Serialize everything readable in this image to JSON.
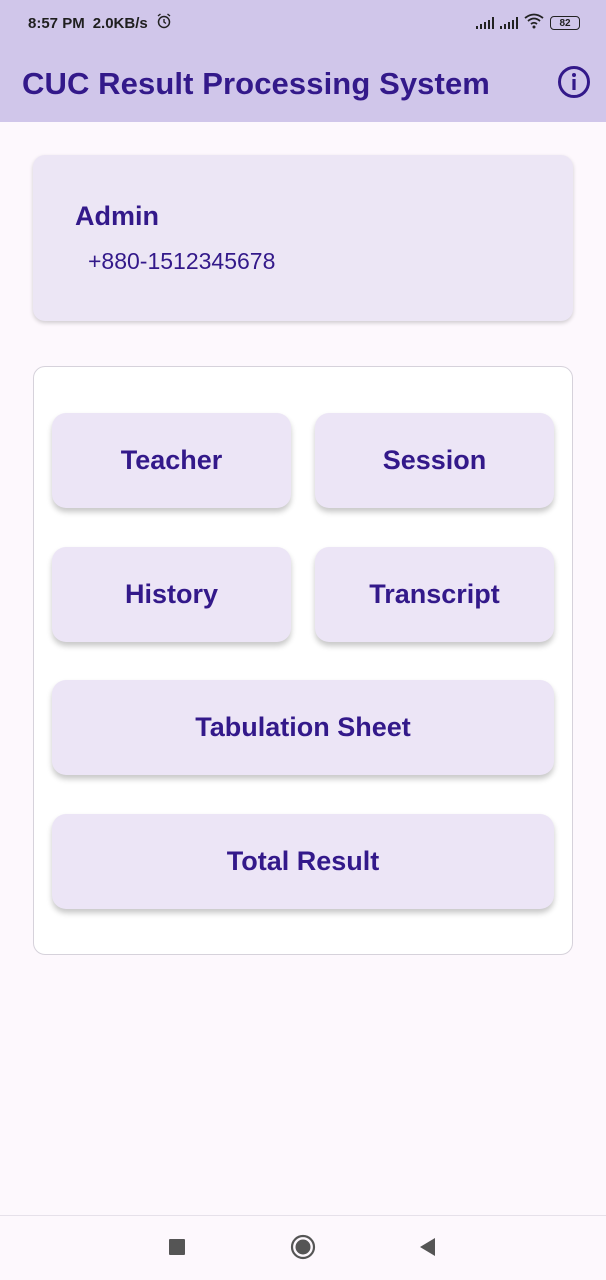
{
  "status_bar": {
    "time": "8:57 PM",
    "speed": "2.0KB/s",
    "battery": "82",
    "icons": [
      "alarm-icon",
      "signal-icon",
      "signal-icon",
      "wifi-icon",
      "battery-icon"
    ]
  },
  "app_bar": {
    "title": "CUC Result Processing System",
    "info_icon": "info-icon"
  },
  "profile": {
    "name": "Admin",
    "phone": "+880-1512345678"
  },
  "menu": {
    "teacher": "Teacher",
    "session": "Session",
    "history": "History",
    "transcript": "Transcript",
    "tabulation_sheet": "Tabulation Sheet",
    "total_result": "Total Result"
  },
  "nav_bar": {
    "icons": [
      "recents-square-icon",
      "home-circle-icon",
      "back-triangle-icon"
    ]
  },
  "colors": {
    "app_bar_bg": "#d0c6ea",
    "accent": "#33198a",
    "card_bg": "#ece6f5",
    "page_bg": "#fdf8fd"
  }
}
